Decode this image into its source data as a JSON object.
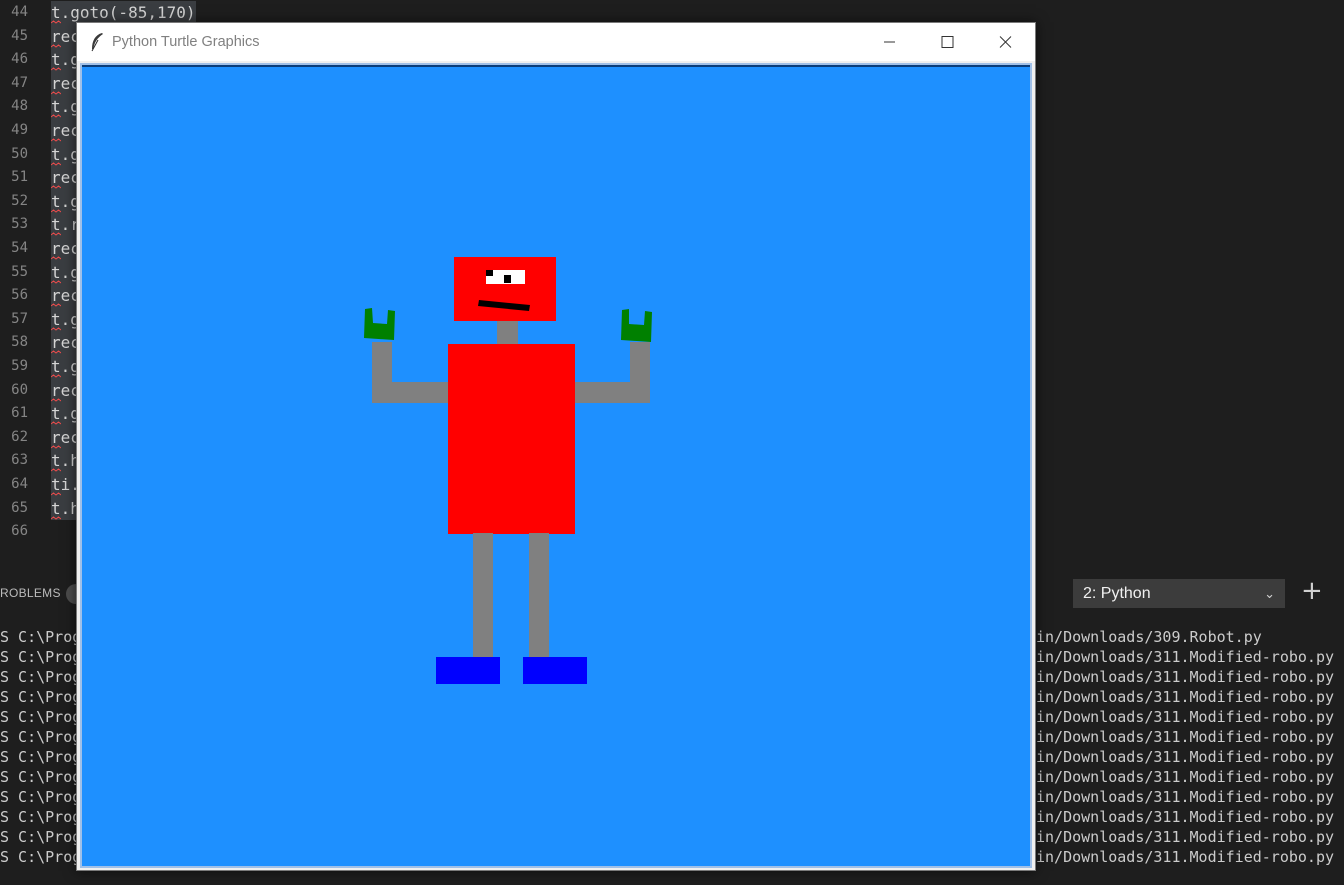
{
  "editor": {
    "lines": [
      {
        "num": "44",
        "text": "t.goto(-85,170)"
      },
      {
        "num": "45",
        "text": "rec"
      },
      {
        "num": "46",
        "text": "t.g"
      },
      {
        "num": "47",
        "text": "rec"
      },
      {
        "num": "48",
        "text": "t.g"
      },
      {
        "num": "49",
        "text": "rec"
      },
      {
        "num": "50",
        "text": "t.g"
      },
      {
        "num": "51",
        "text": "rec"
      },
      {
        "num": "52",
        "text": "t.g"
      },
      {
        "num": "53",
        "text": "t.r"
      },
      {
        "num": "54",
        "text": "rec"
      },
      {
        "num": "55",
        "text": "t.g"
      },
      {
        "num": "56",
        "text": "rec"
      },
      {
        "num": "57",
        "text": "t.g"
      },
      {
        "num": "58",
        "text": "rec"
      },
      {
        "num": "59",
        "text": "t.g"
      },
      {
        "num": "60",
        "text": "rec"
      },
      {
        "num": "61",
        "text": "t.g"
      },
      {
        "num": "62",
        "text": "rec"
      },
      {
        "num": "63",
        "text": "t.h"
      },
      {
        "num": "64",
        "text": "ti."
      },
      {
        "num": "65",
        "text": "t.h"
      },
      {
        "num": "66",
        "text": ""
      }
    ]
  },
  "panel": {
    "problems_label": "ROBLEMS",
    "terminal_select": "2: Python",
    "chevron_icon": "chevron-down-icon",
    "plus_label": "+"
  },
  "terminal": {
    "lines": [
      {
        "left": "S C:\\Prog",
        "right": "in/Downloads/309.Robot.py"
      },
      {
        "left": "S C:\\Prog",
        "right": "in/Downloads/311.Modified-robo.py"
      },
      {
        "left": "S C:\\Prog",
        "right": "in/Downloads/311.Modified-robo.py"
      },
      {
        "left": "S C:\\Prog",
        "right": "in/Downloads/311.Modified-robo.py"
      },
      {
        "left": "S C:\\Prog",
        "right": "in/Downloads/311.Modified-robo.py"
      },
      {
        "left": "S C:\\Prog",
        "right": "in/Downloads/311.Modified-robo.py"
      },
      {
        "left": "S C:\\Prog",
        "right": "in/Downloads/311.Modified-robo.py"
      },
      {
        "left": "S C:\\Prog",
        "right": "in/Downloads/311.Modified-robo.py"
      },
      {
        "left": "S C:\\Prog",
        "right": "in/Downloads/311.Modified-robo.py"
      },
      {
        "left": "S C:\\Prog",
        "right": "in/Downloads/311.Modified-robo.py"
      },
      {
        "left": "S C:\\Prog",
        "right": "in/Downloads/311.Modified-robo.py"
      },
      {
        "left": "S C:\\Prog",
        "right": "in/Downloads/311.Modified-robo.py"
      }
    ]
  },
  "window": {
    "title": "Python Turtle Graphics",
    "icons": [
      "feather-icon",
      "minimize-icon",
      "maximize-icon",
      "close-icon"
    ]
  },
  "canvas": {
    "background": "#1e90ff",
    "colors": {
      "head": "#ff0000",
      "body": "#ff0000",
      "limbs": "#808080",
      "hands": "#008000",
      "feet": "#0000ff",
      "eye_white": "#ffffff",
      "pupil": "#000000",
      "mouth": "#000000"
    }
  }
}
